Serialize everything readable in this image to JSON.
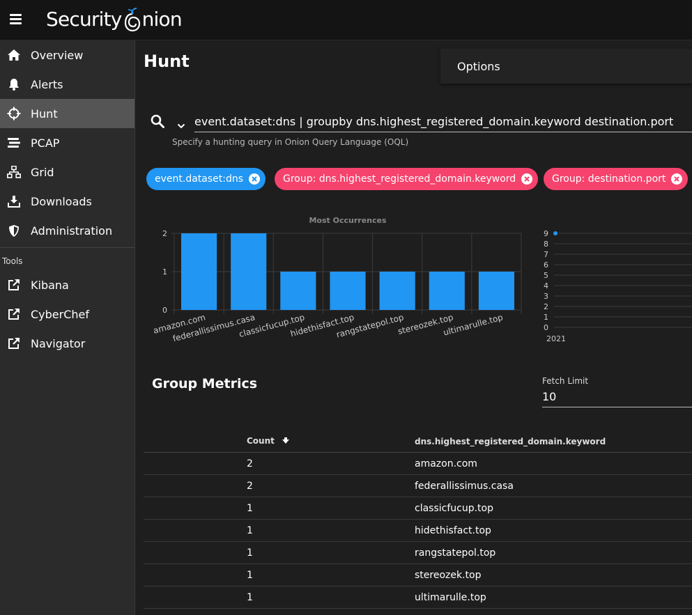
{
  "app": {
    "logo_text_a": "Security",
    "logo_text_b": "nion"
  },
  "sidebar": {
    "items": [
      {
        "label": "Overview",
        "icon": "home-icon"
      },
      {
        "label": "Alerts",
        "icon": "bell-icon"
      },
      {
        "label": "Hunt",
        "icon": "crosshairs-icon",
        "active": true
      },
      {
        "label": "PCAP",
        "icon": "stream-icon"
      },
      {
        "label": "Grid",
        "icon": "sitemap-icon"
      },
      {
        "label": "Downloads",
        "icon": "download-icon"
      },
      {
        "label": "Administration",
        "icon": "shield-icon"
      }
    ],
    "tools_label": "Tools",
    "tools": [
      {
        "label": "Kibana",
        "icon": "external-link-icon"
      },
      {
        "label": "CyberChef",
        "icon": "external-link-icon"
      },
      {
        "label": "Navigator",
        "icon": "external-link-icon"
      }
    ]
  },
  "main": {
    "title": "Hunt",
    "options_label": "Options",
    "query": "event.dataset:dns | groupby dns.highest_registered_domain.keyword destination.port",
    "query_hint": "Specify a hunting query in Onion Query Language (OQL)",
    "chips": [
      {
        "label": "event.dataset:dns",
        "color": "#2196f3"
      },
      {
        "label": "Group: dns.highest_registered_domain.keyword",
        "color": "#f5436d"
      },
      {
        "label": "Group: destination.port",
        "color": "#f5436d"
      }
    ],
    "group_metrics_title": "Group Metrics",
    "fetch_limit_label": "Fetch Limit",
    "fetch_limit_value": "10"
  },
  "table": {
    "headers": {
      "count": "Count",
      "domain": "dns.highest_registered_domain.keyword"
    },
    "rows": [
      {
        "count": "2",
        "domain": "amazon.com"
      },
      {
        "count": "2",
        "domain": "federallissimus.casa"
      },
      {
        "count": "1",
        "domain": "classicfucup.top"
      },
      {
        "count": "1",
        "domain": "hidethisfact.top"
      },
      {
        "count": "1",
        "domain": "rangstatepol.top"
      },
      {
        "count": "1",
        "domain": "stereozek.top"
      },
      {
        "count": "1",
        "domain": "ultimarulle.top"
      }
    ]
  },
  "chart_data": [
    {
      "type": "bar",
      "title": "Most Occurrences",
      "categories": [
        "amazon.com",
        "federallissimus.casa",
        "classicfucup.top",
        "hidethisfact.top",
        "rangstatepol.top",
        "stereozek.top",
        "ultimarulle.top"
      ],
      "values": [
        2,
        2,
        1,
        1,
        1,
        1,
        1
      ],
      "ylim": [
        0,
        2
      ],
      "yticks": [
        0,
        1,
        2
      ],
      "color": "#2196f3",
      "grid": true
    },
    {
      "type": "line",
      "x": [
        "2021"
      ],
      "values": [
        9
      ],
      "ylim": [
        0,
        9
      ],
      "yticks": [
        0,
        1,
        2,
        3,
        4,
        5,
        6,
        7,
        8,
        9
      ],
      "color": "#2196f3",
      "grid": true
    }
  ],
  "colors": {
    "accent": "#2196f3",
    "chip_pink": "#f5436d",
    "active_nav": "#555555"
  }
}
